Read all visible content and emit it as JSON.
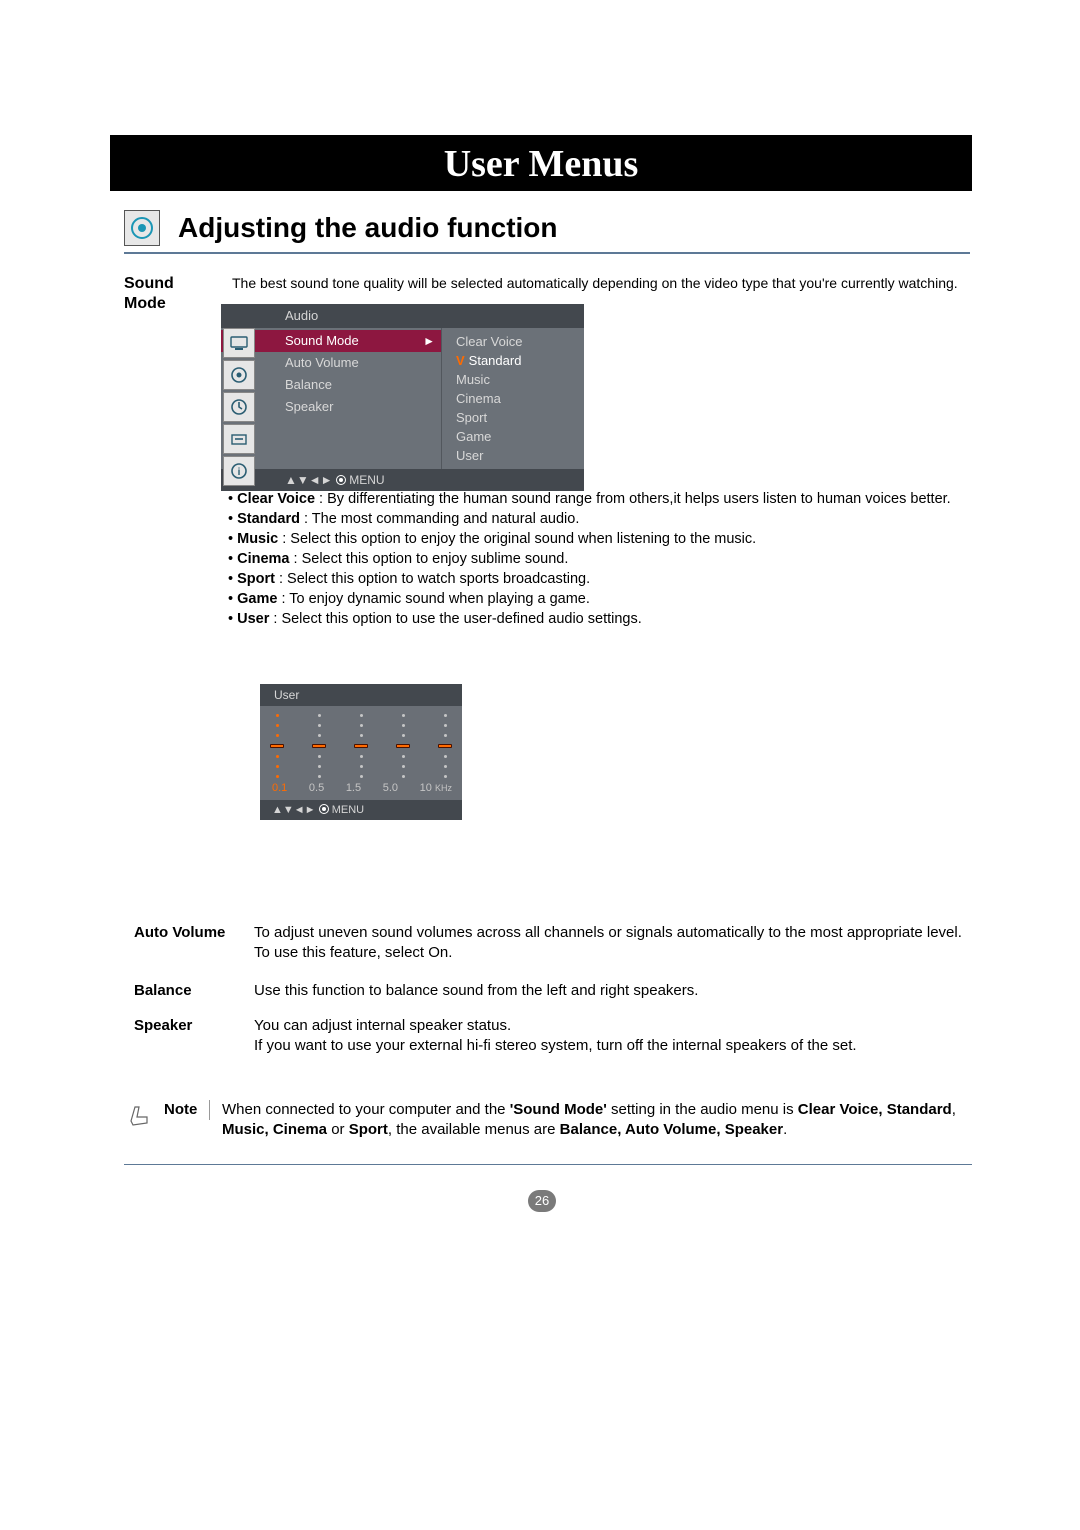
{
  "title": "User Menus",
  "section_title": "Adjusting the audio function",
  "sound_mode": {
    "label_line1": "Sound",
    "label_line2": "Mode",
    "intro": "The best sound tone quality will be selected automatically depending on the video type that you're currently watching."
  },
  "osd": {
    "header": "Audio",
    "items": [
      "Sound Mode",
      "Auto Volume",
      "Balance",
      "Speaker"
    ],
    "options": [
      "Clear Voice",
      "Standard",
      "Music",
      "Cinema",
      "Sport",
      "Game",
      "User"
    ],
    "selected_option": "Standard",
    "nav_glyphs": "▲▼◄►",
    "nav_label": "MENU"
  },
  "mode_descriptions": [
    {
      "name": "Clear Voice",
      "text": " : By differentiating the human sound range from others,it helps users listen to human voices better."
    },
    {
      "name": "Standard",
      "text": " : The most commanding and natural audio."
    },
    {
      "name": "Music",
      "text": " : Select this option to enjoy the original sound when listening to the music."
    },
    {
      "name": "Cinema",
      "text": " : Select this option to enjoy sublime sound."
    },
    {
      "name": "Sport",
      "text": " : Select this option to watch sports broadcasting."
    },
    {
      "name": "Game",
      "text": " : To enjoy dynamic sound when playing a game."
    },
    {
      "name": "User",
      "text": " : Select this option to use the user-defined audio settings."
    }
  ],
  "eq": {
    "header": "User",
    "labels": [
      "0.1",
      "0.5",
      "1.5",
      "5.0",
      "10"
    ],
    "unit": "KHz"
  },
  "definitions": [
    {
      "label": "Auto Volume",
      "text": "To adjust uneven sound volumes across all channels or signals automatically to the most appropriate level. To use this feature, select On."
    },
    {
      "label": "Balance",
      "text": "Use this function to balance sound from the left and right speakers."
    },
    {
      "label": "Speaker",
      "text": "You can adjust internal speaker status.\nIf you want to use your external hi-fi stereo system, turn off the internal speakers of the set."
    }
  ],
  "note": {
    "label": "Note",
    "text_before": "When connected to your computer and the ",
    "b1": "'Sound Mode'",
    "text_mid1": " setting in the audio menu is ",
    "b2": "Clear Voice, Standard",
    "text_mid2": ", ",
    "b3": "Music, Cinema",
    "text_mid3": " or ",
    "b4": "Sport",
    "text_mid4": ", the available menus are ",
    "b5": "Balance, Auto Volume, Speaker",
    "text_after": "."
  },
  "page_number": "26",
  "chart_data": {
    "type": "bar",
    "title": "User",
    "xlabel": "KHz",
    "ylabel": "",
    "categories": [
      "0.1",
      "0.5",
      "1.5",
      "5.0",
      "10"
    ],
    "values": [
      0,
      0,
      0,
      0,
      0
    ],
    "ylim": [
      -3,
      3
    ]
  }
}
